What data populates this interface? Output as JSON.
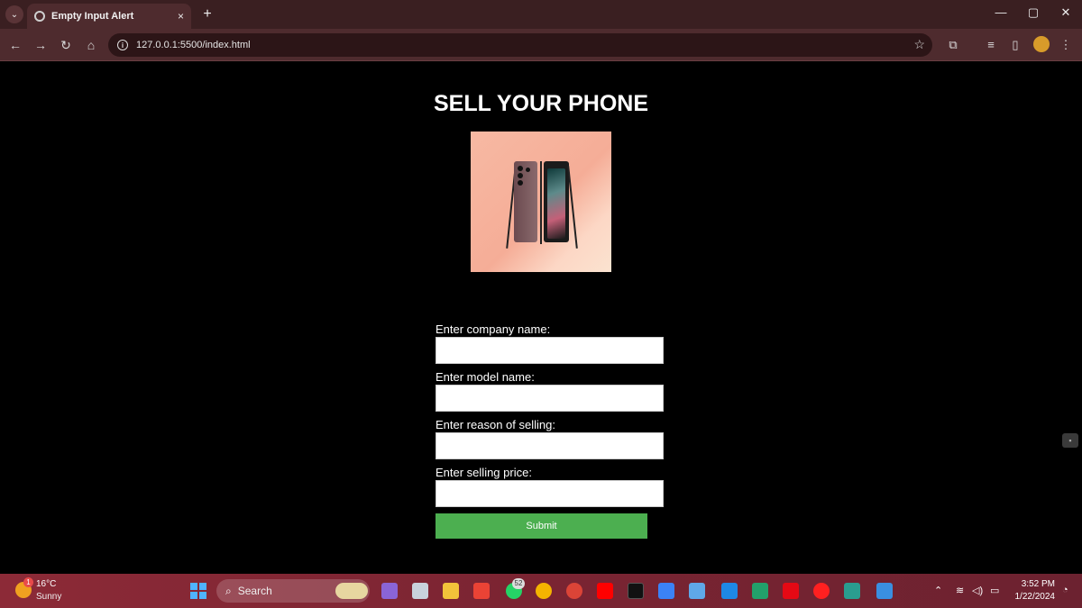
{
  "browser": {
    "tab_title": "Empty Input Alert",
    "tab_close": "×",
    "new_tab": "+",
    "url": "127.0.0.1:5500/index.html",
    "window_controls": {
      "minimize": "—",
      "restore": "▢",
      "close": "✕"
    }
  },
  "page": {
    "title": "SELL YOUR PHONE",
    "image_icon": "phone-product-image",
    "fields": [
      {
        "label": "Enter company name:",
        "value": ""
      },
      {
        "label": "Enter model name:",
        "value": ""
      },
      {
        "label": "Enter reason of selling:",
        "value": ""
      },
      {
        "label": "Enter selling price:",
        "value": ""
      }
    ],
    "submit_label": "Submit",
    "submit_color": "#4caf50"
  },
  "taskbar": {
    "weather": {
      "temp": "16°C",
      "condition": "Sunny",
      "badge": "1"
    },
    "search_label": "Search",
    "whatsapp_badge": "52",
    "clock": {
      "time": "3:52 PM",
      "date": "1/22/2024"
    }
  }
}
